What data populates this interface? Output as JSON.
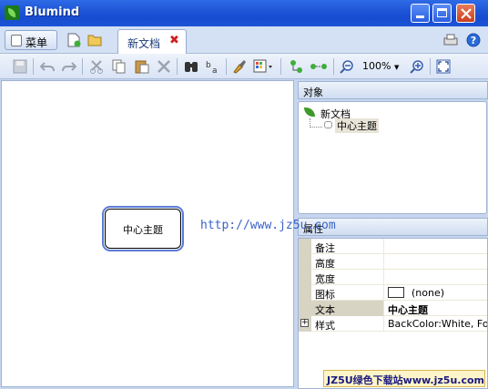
{
  "window": {
    "title": "Blumind"
  },
  "menu": {
    "label": "菜单"
  },
  "tabs": [
    {
      "label": "新文档",
      "close": "✖"
    }
  ],
  "toolbar": {
    "zoom": "100%",
    "zoom_arrow": "▼"
  },
  "canvas": {
    "node_label": "中心主题",
    "watermark": "http://www.jz5u.com"
  },
  "objects_panel": {
    "title": "对象",
    "root": "新文档",
    "child": "中心主题"
  },
  "properties_panel": {
    "title": "属性",
    "rows": [
      {
        "name": "备注",
        "value": ""
      },
      {
        "name": "高度",
        "value": ""
      },
      {
        "name": "宽度",
        "value": ""
      },
      {
        "name": "图标",
        "value": "(none)"
      },
      {
        "name": "文本",
        "value": "中心主题"
      },
      {
        "name": "样式",
        "value": "BackColor:White, Fore"
      }
    ]
  },
  "banner": {
    "text": "JZ5U绿色下载站www.jz5u.com"
  },
  "colors": {
    "title_bar": "#1f56d8",
    "node_border": "#5a7bd8",
    "watermark": "#3a63c8"
  }
}
